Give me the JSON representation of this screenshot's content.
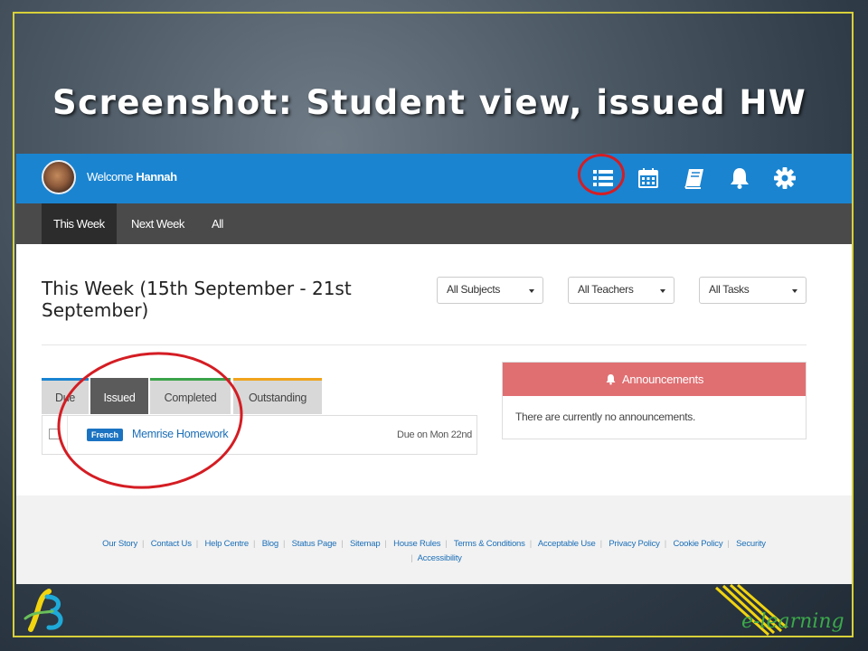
{
  "slide": {
    "title": "Screenshot: Student view, issued HW",
    "frame_color": "#d8d03a",
    "corner_right_text": "e-learning"
  },
  "app": {
    "header": {
      "welcome_prefix": "Welcome",
      "user_name": "Hannah",
      "bar_color": "#1a84d1",
      "icons": [
        "list-icon",
        "calendar-icon",
        "book-icon",
        "bell-icon",
        "gear-icon"
      ]
    },
    "nav": {
      "tabs": [
        {
          "label": "This Week",
          "active": true
        },
        {
          "label": "Next Week",
          "active": false
        },
        {
          "label": "All",
          "active": false
        }
      ]
    },
    "main": {
      "heading": "This Week (15th September - 21st September)",
      "filters": [
        {
          "selected": "All Subjects"
        },
        {
          "selected": "All Teachers"
        },
        {
          "selected": "All Tasks"
        }
      ],
      "homework_tabs": [
        {
          "label": "Due",
          "accent": "#1a84d1"
        },
        {
          "label": "Issued",
          "accent": "#5b5b5b"
        },
        {
          "label": "Completed",
          "accent": "#3aa34a"
        },
        {
          "label": "Outstanding",
          "accent": "#f0a31c"
        }
      ],
      "homework_items": [
        {
          "subject": "French",
          "title": "Memrise Homework",
          "due": "Due on Mon 22nd"
        }
      ],
      "announcements": {
        "title": "Announcements",
        "header_color": "#e06f72",
        "empty_text": "There are currently no announcements."
      }
    },
    "footer": {
      "links": [
        "Our Story",
        "Contact Us",
        "Help Centre",
        "Blog",
        "Status Page",
        "Sitemap",
        "House Rules",
        "Terms & Conditions",
        "Acceptable Use",
        "Privacy Policy",
        "Cookie Policy",
        "Security",
        "Accessibility"
      ]
    }
  },
  "annotation_color": "#d41d23"
}
